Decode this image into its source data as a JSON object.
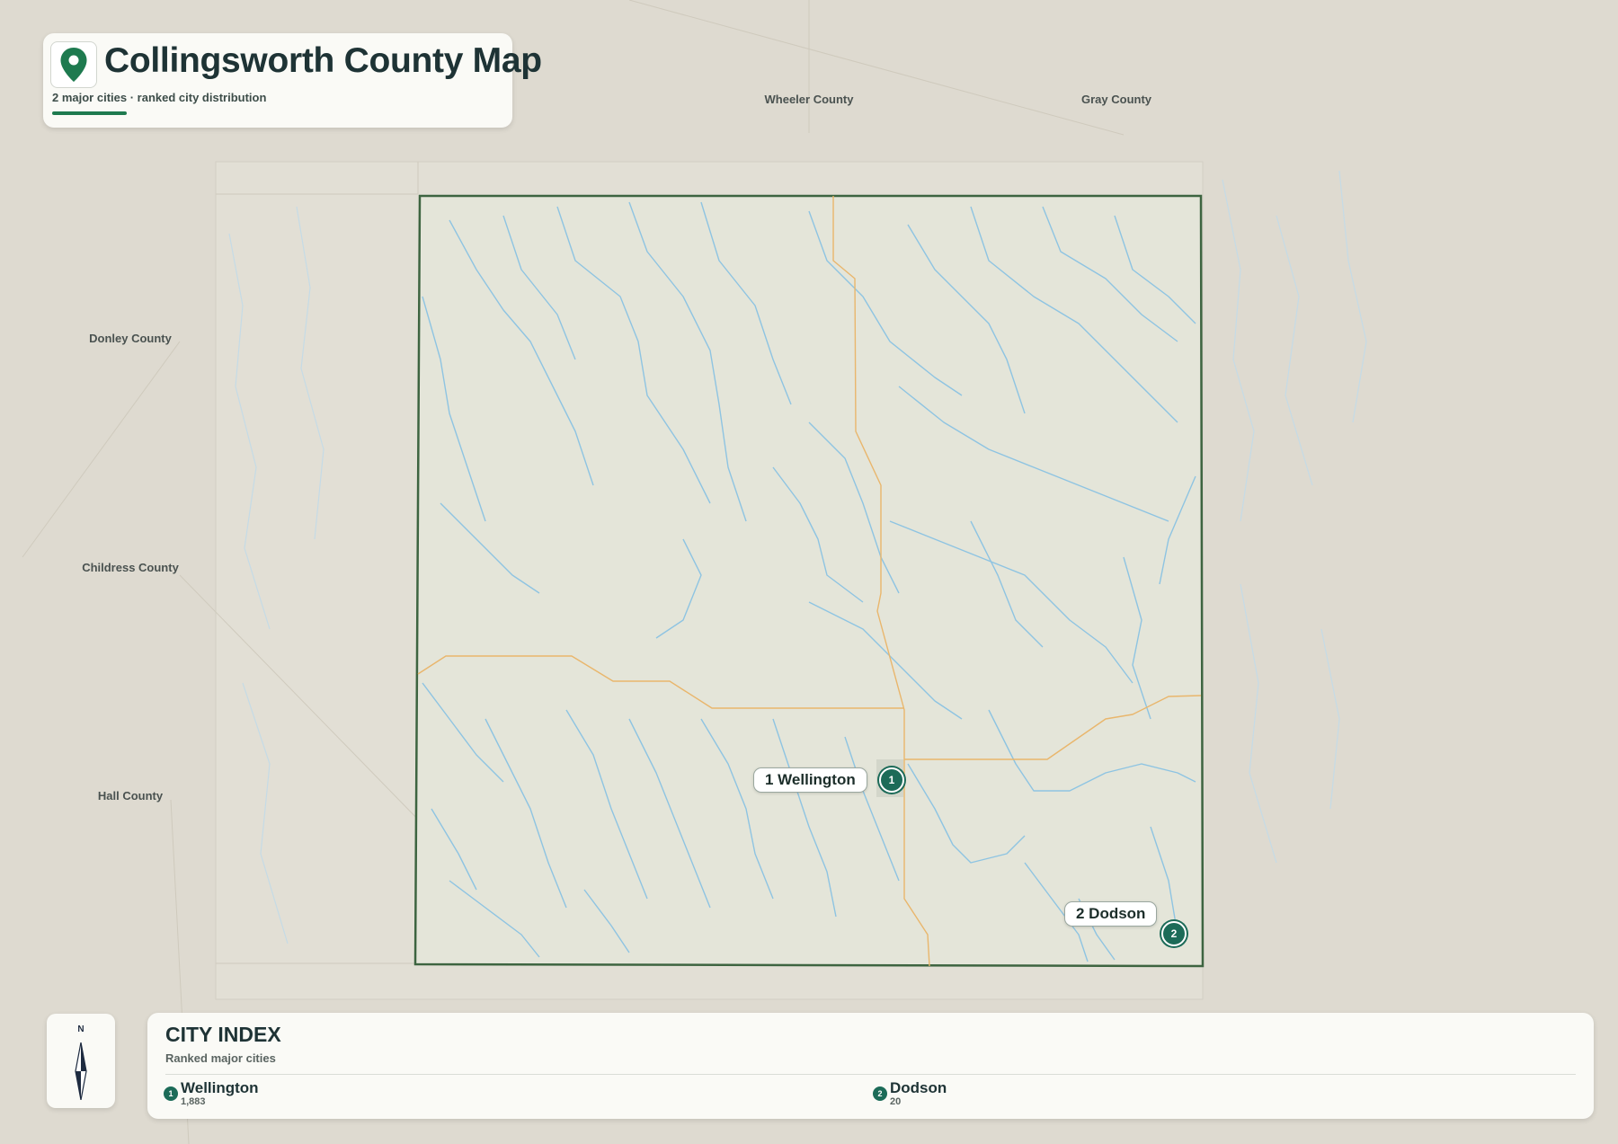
{
  "header": {
    "title": "Collingsworth County Map",
    "subtitle": "2 major cities · ranked city distribution"
  },
  "neighbor_counties": [
    {
      "name": "Wheeler County"
    },
    {
      "name": "Gray County"
    },
    {
      "name": "Donley County"
    },
    {
      "name": "Childress County"
    },
    {
      "name": "Hall County"
    }
  ],
  "cities": [
    {
      "rank": "1",
      "name": "Wellington",
      "callout": "1 Wellington",
      "population": "1,883"
    },
    {
      "rank": "2",
      "name": "Dodson",
      "callout": "2 Dodson",
      "population": "20"
    }
  ],
  "compass": {
    "label": "N"
  },
  "city_index": {
    "title": "CITY INDEX",
    "subtitle": "Ranked major cities"
  },
  "colors": {
    "background": "#dedad0",
    "county_fill": "#e4e5d9",
    "county_border": "#3d6440",
    "rivers": "#8ec4e2",
    "roads": "#e9b66c",
    "accent": "#1e7a4f",
    "marker": "#1c6b58"
  },
  "icons": {
    "title_icon": "map-pin-icon",
    "compass": "compass-arrow-icon"
  }
}
